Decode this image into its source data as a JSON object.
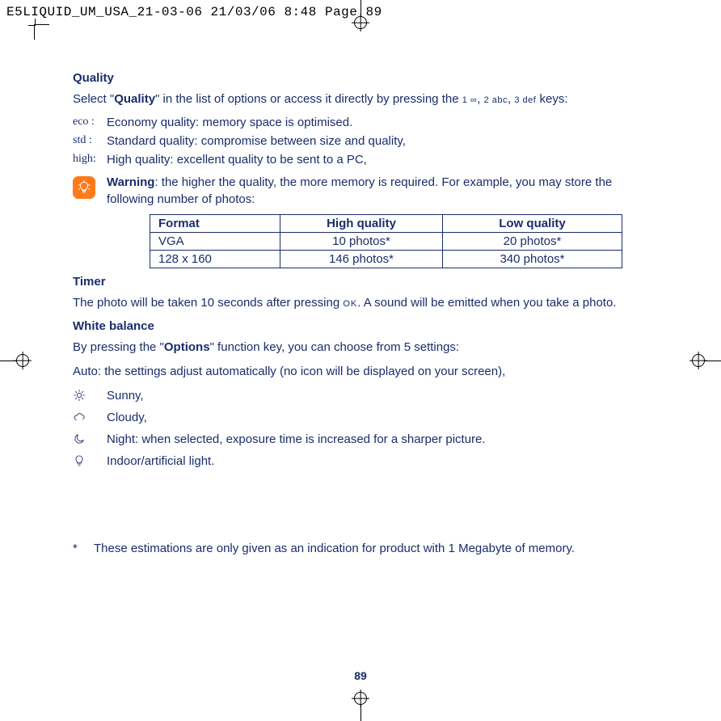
{
  "header": "E5LIQUID_UM_USA_21-03-06  21/03/06  8:48  Page 89",
  "page_number": "89",
  "quality": {
    "title": "Quality",
    "intro_pre": "Select \"",
    "intro_bold": "Quality",
    "intro_post": "\" in the list of options or access it directly by pressing the ",
    "key1": "1 ∞",
    "key2": "2 abc",
    "key3": "3 def",
    "intro_end": " keys:",
    "defs": [
      {
        "icon": "eco :",
        "text": "Economy quality: memory space is optimised."
      },
      {
        "icon": "std :",
        "text": "Standard quality: compromise between size and quality,"
      },
      {
        "icon": "high:",
        "text": "High quality: excellent quality to be sent to a PC,"
      }
    ],
    "warning_bold": "Warning",
    "warning_text": ": the higher the quality, the more memory is required. For example, you may store the following number of photos:",
    "table": {
      "headers": [
        "Format",
        "High quality",
        "Low quality"
      ],
      "rows": [
        [
          "VGA",
          "10 photos*",
          "20 photos*"
        ],
        [
          "128 x 160",
          "146 photos*",
          "340 photos*"
        ]
      ]
    }
  },
  "timer": {
    "title": "Timer",
    "pre": "The photo will be taken 10 seconds after pressing ",
    "ok": "OK",
    "post": ". A sound will be emitted when you take a photo."
  },
  "white_balance": {
    "title": "White balance",
    "intro_pre": "By pressing the \"",
    "intro_bold": "Options",
    "intro_post": "\" function key, you can choose from 5 settings:",
    "auto_line": "Auto: the settings adjust automatically (no icon will be displayed on your screen),",
    "items": [
      {
        "icon": "sun",
        "text": "Sunny,"
      },
      {
        "icon": "cloud",
        "text": "Cloudy,"
      },
      {
        "icon": "moon",
        "text": "Night: when selected, exposure time is increased for a sharper picture."
      },
      {
        "icon": "bulb",
        "text": "Indoor/artificial light."
      }
    ]
  },
  "footnote": {
    "ast": "*",
    "text": "These estimations are only given as an indication for product with 1 Megabyte of memory."
  }
}
